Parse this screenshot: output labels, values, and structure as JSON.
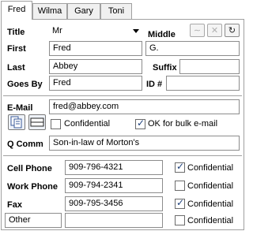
{
  "tabs": [
    "Fred",
    "Wilma",
    "Gary",
    "Toni"
  ],
  "name": {
    "title_label": "Title",
    "title_value": "Mr",
    "middle_label": "Middle",
    "middle_value": "G.",
    "first_label": "First",
    "first_value": "Fred",
    "last_label": "Last",
    "last_value": "Abbey",
    "suffix_label": "Suffix",
    "suffix_value": "",
    "goes_by_label": "Goes By",
    "goes_by_value": "Fred",
    "id_label": "ID #",
    "id_value": ""
  },
  "email": {
    "label": "E-Mail",
    "value": "fred@abbey.com",
    "confidential_label": "Confidential",
    "confidential_checked": false,
    "bulk_label": "OK for bulk e-mail",
    "bulk_checked": true
  },
  "qcomm": {
    "label": "Q Comm",
    "value": "Son-in-law of Morton's"
  },
  "phones": [
    {
      "label": "Cell Phone",
      "value": "909-796-4321",
      "conf_label": "Confidential",
      "checked": true
    },
    {
      "label": "Work Phone",
      "value": "909-794-2341",
      "conf_label": "Confidential",
      "checked": false
    },
    {
      "label": "Fax",
      "value": "909-795-3456",
      "conf_label": "Confidential",
      "checked": true
    },
    {
      "label": "Other",
      "value": "",
      "conf_label": "Confidential",
      "checked": false
    }
  ],
  "checkmark": "✓",
  "icons": {
    "button1": "signature-icon",
    "button2": "erase-icon",
    "button3": "refresh-icon",
    "email1": "address-card-icon",
    "email2": "envelope-icon"
  }
}
